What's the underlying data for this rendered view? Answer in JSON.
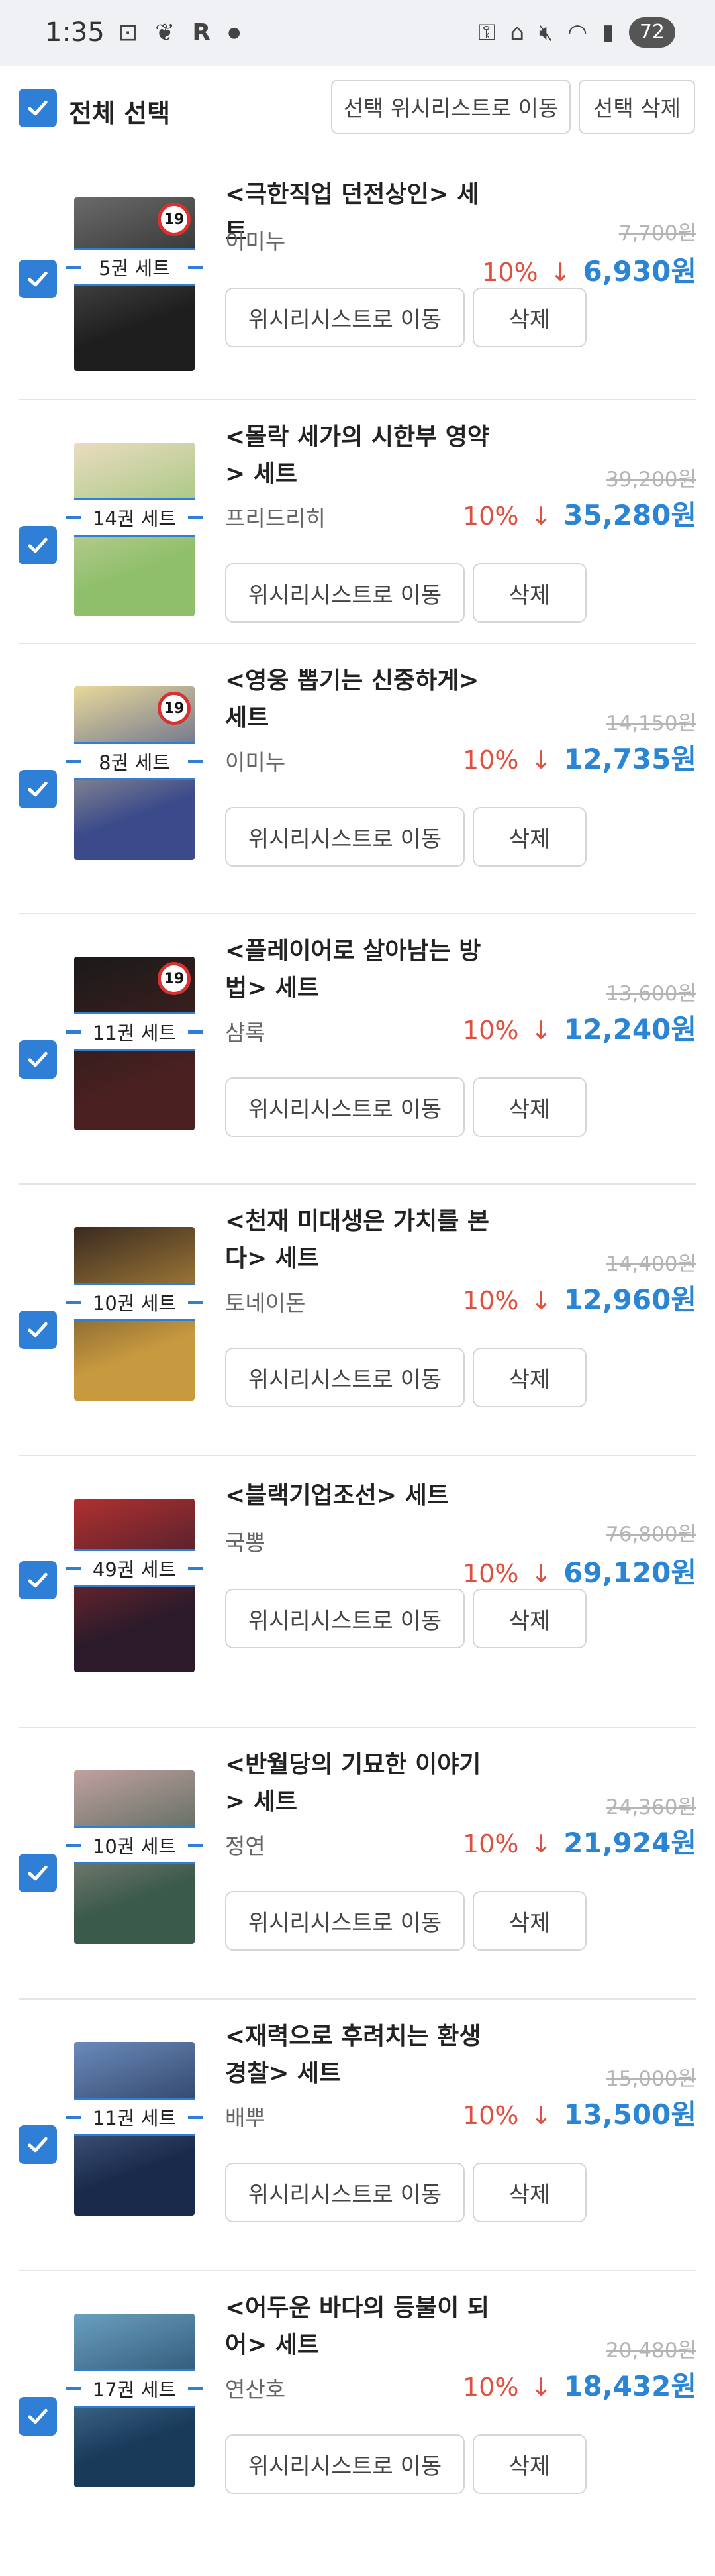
{
  "status_bar": {
    "time": "1:35",
    "battery": "72",
    "left_icons": [
      "screenshot-icon",
      "leaf-icon",
      "r-icon",
      "dot-icon"
    ],
    "right_icons": [
      "key-icon",
      "home-icon",
      "mute-icon",
      "wifi-icon",
      "signal-icon"
    ]
  },
  "header": {
    "select_all_label": "전체 선택",
    "move_selected_label": "선택 위시리스트로 이동",
    "delete_selected_label": "선택 삭제"
  },
  "colors": {
    "accent": "#2f7fd6",
    "discount": "#e0503f",
    "sale_price": "#2a85d4",
    "age_badge": "#d93030"
  },
  "buttons": {
    "wishlist_label": "위시리시스트로 이동",
    "delete_label": "삭제"
  },
  "items": [
    {
      "title": "<극한직업 던전상인> 세트",
      "author": "이미누",
      "set_count": "5권 세트",
      "original_price": "7,700원",
      "discount": "10%",
      "sale_price": "6,930원",
      "age_rating": "19",
      "cover_colors": [
        "#1e1e1e",
        "#6a6a6a"
      ]
    },
    {
      "title": "<몰락 세가의 시한부 영약> 세트",
      "author": "프리드리히",
      "set_count": "14권 세트",
      "original_price": "39,200원",
      "discount": "10%",
      "sale_price": "35,280원",
      "age_rating": "",
      "cover_colors": [
        "#8fbf6a",
        "#e9dcc0"
      ]
    },
    {
      "title": "<영웅 뽑기는 신중하게> 세트",
      "author": "이미누",
      "set_count": "8권 세트",
      "original_price": "14,150원",
      "discount": "10%",
      "sale_price": "12,735원",
      "age_rating": "19",
      "cover_colors": [
        "#3b4a8a",
        "#e8d89a"
      ]
    },
    {
      "title": "<플레이어로 살아남는 방법> 세트",
      "author": "샴록",
      "set_count": "11권 세트",
      "original_price": "13,600원",
      "discount": "10%",
      "sale_price": "12,240원",
      "age_rating": "19",
      "cover_colors": [
        "#4a2020",
        "#1a1a1a"
      ]
    },
    {
      "title": "<천재 미대생은 가치를 본다> 세트",
      "author": "토네이돈",
      "set_count": "10권 세트",
      "original_price": "14,400원",
      "discount": "10%",
      "sale_price": "12,960원",
      "age_rating": "",
      "cover_colors": [
        "#c89a40",
        "#3a2a20"
      ]
    },
    {
      "title": "<블랙기업조선> 세트",
      "author": "국뽕",
      "set_count": "49권 세트",
      "original_price": "76,800원",
      "discount": "10%",
      "sale_price": "69,120원",
      "age_rating": "",
      "cover_colors": [
        "#2a1a2a",
        "#b03030"
      ]
    },
    {
      "title": "<반월당의 기묘한 이야기> 세트",
      "author": "정연",
      "set_count": "10권 세트",
      "original_price": "24,360원",
      "discount": "10%",
      "sale_price": "21,924원",
      "age_rating": "",
      "cover_colors": [
        "#3a5a4a",
        "#c0a0a0"
      ]
    },
    {
      "title": "<재력으로 후려치는 환생경찰> 세트",
      "author": "배뿌",
      "set_count": "11권 세트",
      "original_price": "15,000원",
      "discount": "10%",
      "sale_price": "13,500원",
      "age_rating": "",
      "cover_colors": [
        "#1a2a4a",
        "#6a8aba"
      ]
    },
    {
      "title": "<어두운 바다의 등불이 되어> 세트",
      "author": "연산호",
      "set_count": "17권 세트",
      "original_price": "20,480원",
      "discount": "10%",
      "sale_price": "18,432원",
      "age_rating": "",
      "cover_colors": [
        "#1a3a5a",
        "#6aa0c0"
      ]
    }
  ]
}
